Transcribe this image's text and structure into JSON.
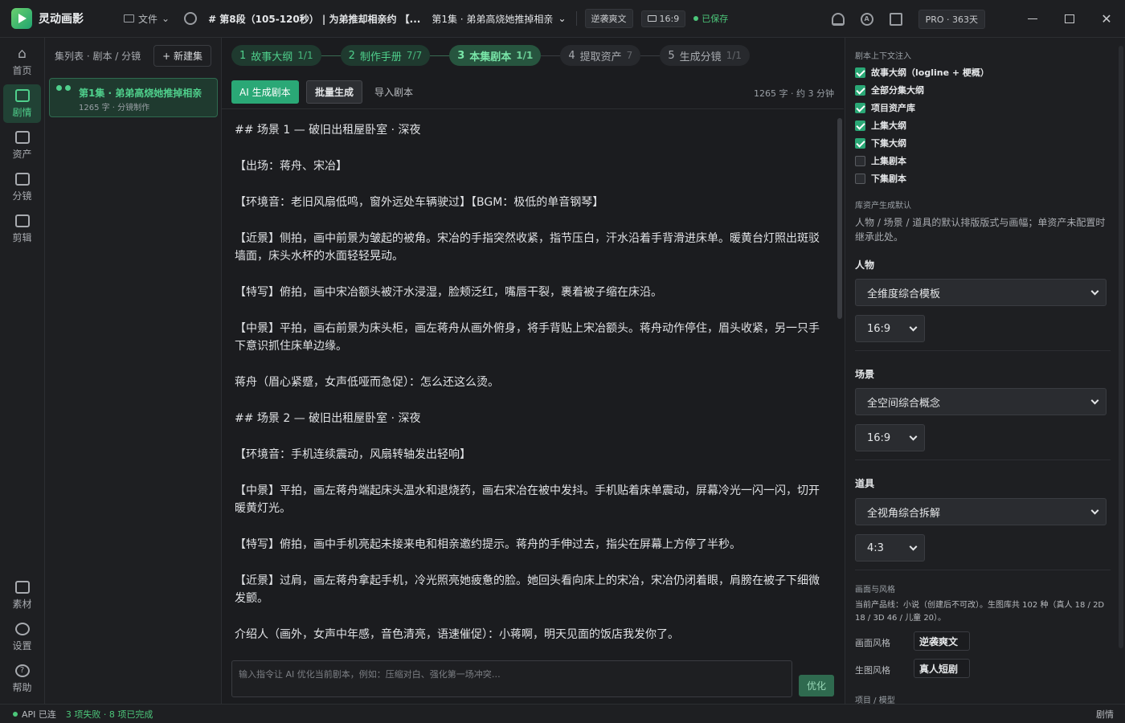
{
  "app": {
    "name": "灵动画影"
  },
  "topbar": {
    "file_menu": "文件",
    "segment": "# 第8段（105-120秒） | 为弟推却相亲约 【...",
    "episode_select": "第1集 · 弟弟高烧她推掉相亲",
    "style_chip": "逆袭爽文",
    "ratio_chip": "16:9",
    "saved": "已保存",
    "pro": "PRO · 363天"
  },
  "nav": {
    "items": [
      {
        "label": "首页",
        "icon": "home-icon"
      },
      {
        "label": "剧情",
        "icon": "script-icon",
        "active": true
      },
      {
        "label": "资产",
        "icon": "assets-icon"
      },
      {
        "label": "分镜",
        "icon": "storyboard-icon"
      },
      {
        "label": "剪辑",
        "icon": "edit-icon"
      }
    ],
    "bottom": [
      {
        "label": "素材",
        "icon": "cube-icon"
      },
      {
        "label": "设置",
        "icon": "gear-icon"
      },
      {
        "label": "帮助",
        "icon": "help-icon"
      }
    ]
  },
  "episodes": {
    "header": "集列表 · 剧本 / 分镜",
    "new_button": "+ 新建集",
    "items": [
      {
        "title": "第1集 · 弟弟高烧她推掉相亲",
        "sub": "1265 字 · 分镜制作"
      }
    ]
  },
  "steps": [
    {
      "num": "1",
      "label": "故事大纲",
      "count": "1/1",
      "state": "done"
    },
    {
      "num": "2",
      "label": "制作手册",
      "count": "7/7",
      "state": "done"
    },
    {
      "num": "3",
      "label": "本集剧本",
      "count": "1/1",
      "state": "current"
    },
    {
      "num": "4",
      "label": "提取资产",
      "count": "7",
      "state": "todo"
    },
    {
      "num": "5",
      "label": "生成分镜",
      "count": "1/1",
      "state": "todo"
    }
  ],
  "toolbar": {
    "ai_button": "AI 生成剧本",
    "batch_button": "批量生成",
    "import_button": "导入剧本",
    "word_count": "1265 字 · 约 3 分钟"
  },
  "script_lines": [
    "## 场景 1 — 破旧出租屋卧室 · 深夜",
    "【出场：蒋舟、宋冶】",
    "【环境音：老旧风扇低鸣，窗外远处车辆驶过】【BGM：极低的单音钢琴】",
    "【近景】侧拍，画中前景为皱起的被角。宋冶的手指突然收紧，指节压白，汗水沿着手背滑进床单。暖黄台灯照出斑驳墙面，床头水杯的水面轻轻晃动。",
    "【特写】俯拍，画中宋冶额头被汗水浸湿，脸颊泛红，嘴唇干裂，裹着被子缩在床沿。",
    "【中景】平拍，画右前景为床头柜，画左蒋舟从画外俯身，将手背贴上宋冶额头。蒋舟动作停住，眉头收紧，另一只手下意识抓住床单边缘。",
    "蒋舟（眉心紧蹙，女声低哑而急促）：怎么还这么烫。",
    "## 场景 2 — 破旧出租屋卧室 · 深夜",
    "【环境音：手机连续震动，风扇转轴发出轻响】",
    "【中景】平拍，画左蒋舟端起床头温水和退烧药，画右宋冶在被中发抖。手机贴着床单震动，屏幕冷光一闪一闪，切开暖黄灯光。",
    "【特写】俯拍，画中手机亮起未接来电和相亲邀约提示。蒋舟的手伸过去，指尖在屏幕上方停了半秒。",
    "【近景】过肩，画左蒋舟拿起手机，冷光照亮她疲惫的脸。她回头看向床上的宋冶，宋冶仍闭着眼，肩膀在被子下细微发颤。",
    "介绍人（画外，女声中年感，音色清亮，语速催促）：小蒋啊，明天见面的饭店我发你了。"
  ],
  "command": {
    "placeholder": "输入指令让 AI 优化当前剧本，例如：压缩对白、强化第一场冲突…",
    "button": "优化"
  },
  "right_panel": {
    "context_title": "剧本上下文注入",
    "context_items": [
      {
        "label": "故事大纲（logline + 梗概）",
        "checked": true
      },
      {
        "label": "全部分集大纲",
        "checked": true
      },
      {
        "label": "项目资产库",
        "checked": true
      },
      {
        "label": "上集大纲",
        "checked": true
      },
      {
        "label": "下集大纲",
        "checked": true
      },
      {
        "label": "上集剧本",
        "checked": false
      },
      {
        "label": "下集剧本",
        "checked": false
      }
    ],
    "asset_default_title": "库资产生成默认",
    "asset_default_desc": "人物 / 场景 / 道具的默认排版版式与画幅；单资产未配置时继承此处。",
    "character": {
      "label": "人物",
      "template": "全维度综合模板",
      "ratio": "16:9"
    },
    "scene": {
      "label": "场景",
      "template": "全空间综合概念",
      "ratio": "16:9"
    },
    "prop": {
      "label": "道具",
      "template": "全视角综合拆解",
      "ratio": "4:3"
    },
    "style_title": "画面与风格",
    "style_desc": "当前产品线：小说（创建后不可改）。生图库共 102 种（真人 18 / 2D 18 / 3D 46 / 儿童 20）。",
    "visual_style_label": "画面风格",
    "visual_style_value": "逆袭爽文",
    "gen_style_label": "生图风格",
    "gen_style_value": "真人短剧",
    "project_model_title": "项目 / 模型"
  },
  "status": {
    "api": "API 已连",
    "tasks": "3 项失败 · 8 项已完成",
    "mode": "剧情"
  },
  "colors": {
    "accent": "#2aa876",
    "accent_text": "#4fd08c",
    "bg": "#1b1c1f"
  }
}
